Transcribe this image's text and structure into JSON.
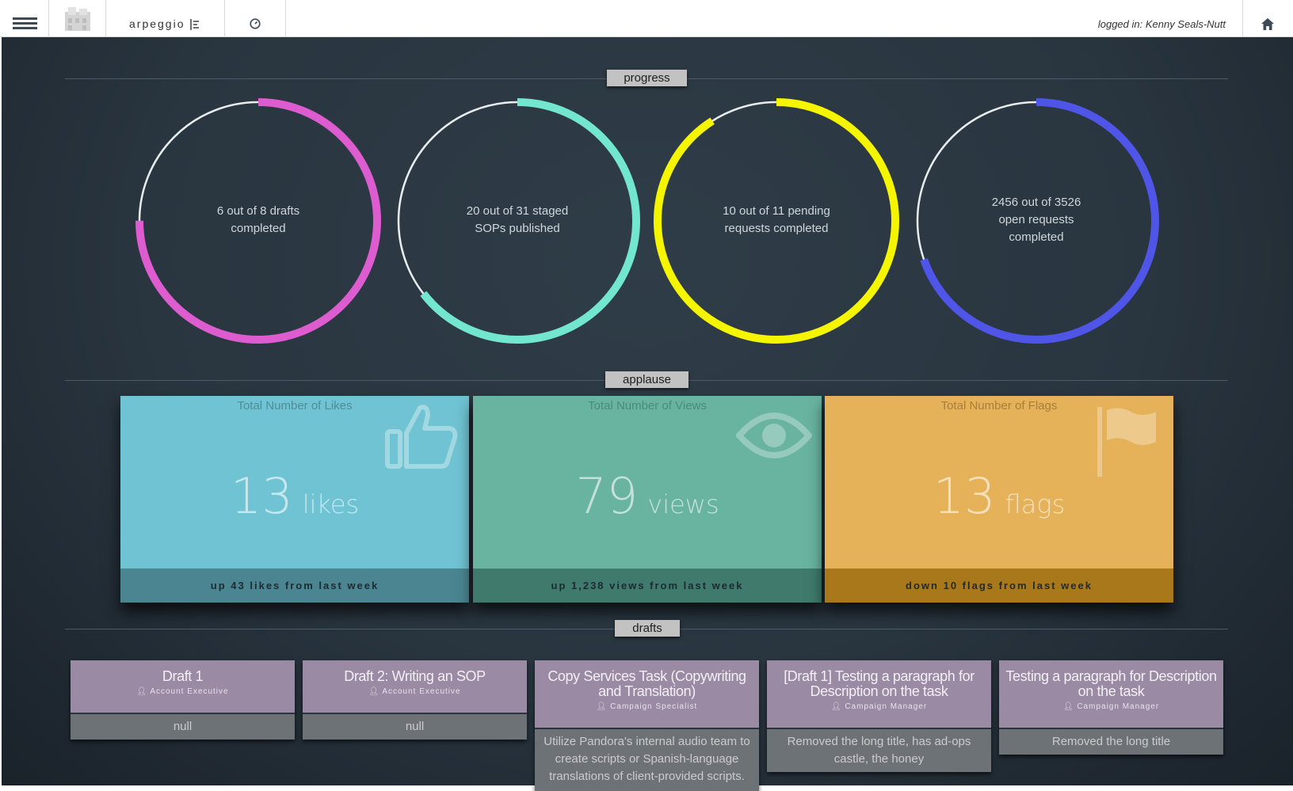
{
  "header": {
    "app_name": "arpeggio",
    "logged_in_text": "logged in: Kenny Seals-Nutt"
  },
  "sections": {
    "progress": "progress",
    "applause": "applause",
    "drafts": "drafts"
  },
  "progress": [
    {
      "line1": "6 out of 8 drafts",
      "line2": "completed",
      "line3": "",
      "fraction": 0.75,
      "color": "#dd5ccf"
    },
    {
      "line1": "20 out of 31 staged",
      "line2": "SOPs published",
      "line3": "",
      "fraction": 0.645,
      "color": "#73e6cf"
    },
    {
      "line1": "10 out of 11 pending",
      "line2": "requests completed",
      "line3": "",
      "fraction": 0.909,
      "color": "#f5f500"
    },
    {
      "line1": "2456 out of 3526",
      "line2": "open requests",
      "line3": "completed",
      "fraction": 0.697,
      "color": "#4f55e6"
    }
  ],
  "applause": [
    {
      "title": "Total Number of Likes",
      "value": "13",
      "unit": "likes",
      "footer": "up 43 likes from last week",
      "icon": "thumbs-up-icon",
      "color": "#6fc3d3",
      "foot_color": "#4b8592",
      "title_color": "#4f8d99"
    },
    {
      "title": "Total Number of Views",
      "value": "79",
      "unit": "views",
      "footer": "up 1,238 views from last week",
      "icon": "eye-icon",
      "color": "#69b3a1",
      "foot_color": "#3f7a6c",
      "title_color": "#4a8c7c"
    },
    {
      "title": "Total Number of Flags",
      "value": "13",
      "unit": "flags",
      "footer": "down 10 flags from last week",
      "icon": "flag-icon",
      "color": "#e5b25a",
      "foot_color": "#a8781b",
      "title_color": "#a87f3a"
    }
  ],
  "drafts": [
    {
      "title": "Draft 1",
      "role": "Account Executive",
      "body": "null"
    },
    {
      "title": "Draft 2: Writing an SOP",
      "role": "Account Executive",
      "body": "null"
    },
    {
      "title": "Copy Services Task (Copywriting and Translation)",
      "role": "Campaign Specialist",
      "body": "Utilize Pandora's internal audio team to create scripts or Spanish-language translations of client-provided scripts."
    },
    {
      "title": "[Draft 1] Testing a paragraph for Description on the task",
      "role": "Campaign Manager",
      "body": "Removed the long title, has ad-ops castle, the honey"
    },
    {
      "title": "Testing a paragraph for Description on the task",
      "role": "Campaign Manager",
      "body": "Removed the long title"
    }
  ]
}
